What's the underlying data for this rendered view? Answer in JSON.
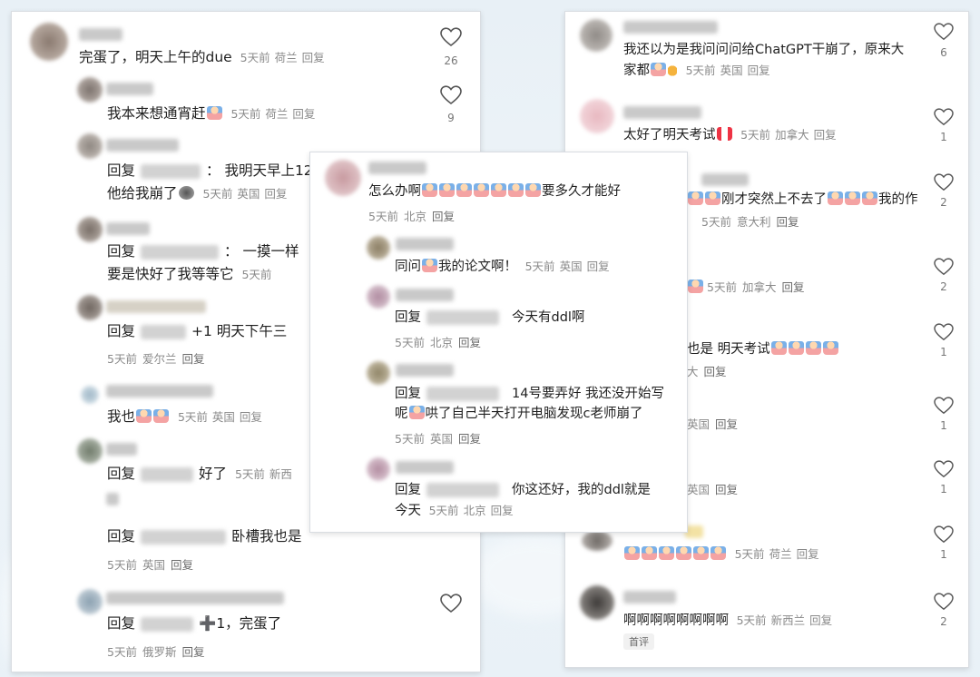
{
  "time_ago": "5天前",
  "reply_label": "回复",
  "left": {
    "comments": [
      {
        "text": "完蛋了，明天上午的due",
        "loc": "荷兰",
        "likes": "26"
      },
      {
        "text": "我本来想通宵赶",
        "loc": "荷兰",
        "likes": "9"
      },
      {
        "text": "：  我明天早上12月",
        "text2": "他给我崩了",
        "loc": "英国"
      },
      {
        "text": "：  一摸一样",
        "text2": "要是快好了我等等它"
      },
      {
        "text": "+1 明天下午三",
        "loc": "爱尔兰"
      },
      {
        "text": "我也",
        "loc": "英国"
      },
      {
        "text": "好了",
        "loc": "新西"
      },
      {
        "text": "卧槽我也是",
        "loc": "英国"
      },
      {
        "text": "➕1，完蛋了",
        "loc": "俄罗斯"
      }
    ]
  },
  "center": {
    "comments": [
      {
        "text": "怎么办啊",
        "text_tail": "要多久才能好",
        "loc": "北京"
      },
      {
        "text": "同问",
        "text_tail": "我的论文啊！",
        "loc": "英国"
      },
      {
        "text": "今天有ddl啊",
        "loc": "北京"
      },
      {
        "text": "14号要弄好 我还没开始写",
        "text2a": "呢",
        "text2b": "哄了自己半天打开电脑发现c老师崩了",
        "loc": "英国"
      },
      {
        "text": "你这还好，我的ddl就是",
        "text2": "今天",
        "loc": "北京"
      }
    ]
  },
  "right": {
    "comments": [
      {
        "text": "我还以为是我问问问给ChatGPT干崩了，原来大",
        "text2": "家都",
        "loc": "英国",
        "likes": "6"
      },
      {
        "text": "太好了明天考试",
        "loc": "加拿大",
        "likes": "1"
      },
      {
        "text": "刚才突然上不去了",
        "text_tail": "我的作",
        "loc": "意大利",
        "likes": "2"
      },
      {
        "loc": "加拿大",
        "likes": "2"
      },
      {
        "text": "也是 明天考试",
        "loc": "大",
        "likes": "1"
      },
      {
        "loc": "英国",
        "likes": "1"
      },
      {
        "loc": "英国",
        "likes": "1"
      },
      {
        "loc": "荷兰",
        "likes": "1"
      },
      {
        "text": "啊啊啊啊啊啊啊啊",
        "loc": "新西兰",
        "likes": "2",
        "tag": "首评"
      }
    ]
  }
}
